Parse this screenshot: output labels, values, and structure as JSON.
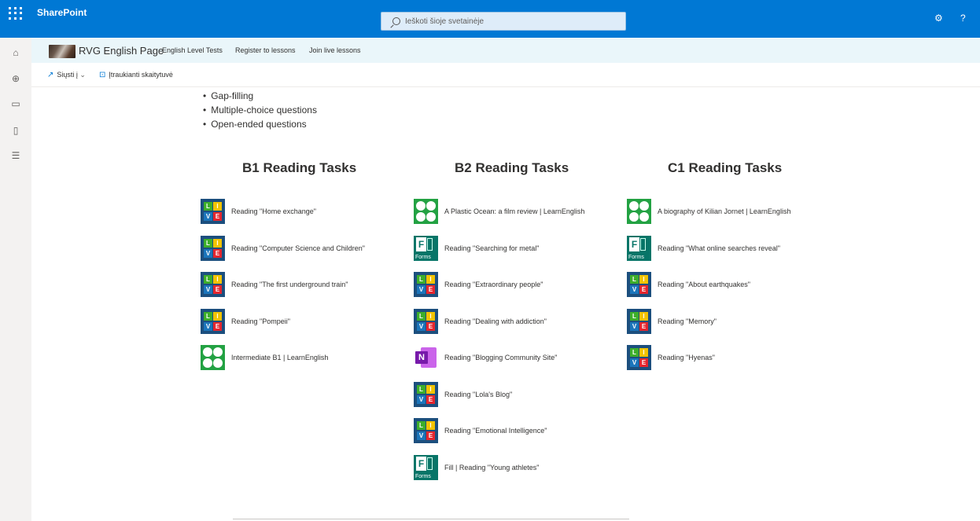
{
  "topbar": {
    "brand": "SharePoint",
    "search_placeholder": "Ieškoti šioje svetainėje",
    "settings_icon": "gear-icon",
    "help_label": "?"
  },
  "site": {
    "title": "RVG English Page",
    "nav": [
      "English Level Tests",
      "Register to lessons",
      "Join live lessons"
    ]
  },
  "commands": {
    "send_label": "Siųsti į",
    "reader_label": "Įtraukianti skaitytuvė"
  },
  "bullets": [
    "Gap-filling",
    "Multiple-choice questions",
    "Open-ended questions"
  ],
  "columns": [
    {
      "title": "B1 Reading Tasks",
      "items": [
        {
          "icon": "live",
          "label": "Reading \"Home exchange\""
        },
        {
          "icon": "live",
          "label": "Reading \"Computer Science and Children\""
        },
        {
          "icon": "live",
          "label": "Reading \"The first underground train\""
        },
        {
          "icon": "live",
          "label": "Reading \"Pompeii\""
        },
        {
          "icon": "learnenglish",
          "label": "Intermediate B1 | LearnEnglish"
        }
      ]
    },
    {
      "title": "B2 Reading Tasks",
      "items": [
        {
          "icon": "learnenglish",
          "label": "A Plastic Ocean: a film review | LearnEnglish"
        },
        {
          "icon": "forms",
          "label": "Reading \"Searching for metal\""
        },
        {
          "icon": "live",
          "label": "Reading \"Extraordinary people\""
        },
        {
          "icon": "live",
          "label": "Reading \"Dealing with addiction\""
        },
        {
          "icon": "onenote",
          "label": "Reading \"Blogging Community Site\""
        },
        {
          "icon": "live",
          "label": "Reading \"Lola's Blog\""
        },
        {
          "icon": "live",
          "label": "Reading \"Emotional Intelligence\""
        },
        {
          "icon": "forms",
          "label": "Fill | Reading \"Young athletes\""
        }
      ]
    },
    {
      "title": "C1 Reading Tasks",
      "items": [
        {
          "icon": "learnenglish",
          "label": "A biography of Kilian Jornet | LearnEnglish"
        },
        {
          "icon": "forms",
          "label": "Reading \"What online searches reveal\""
        },
        {
          "icon": "live",
          "label": "Reading \"About earthquakes\""
        },
        {
          "icon": "live",
          "label": "Reading \"Memory\""
        },
        {
          "icon": "live",
          "label": "Reading \"Hyenas\""
        }
      ]
    }
  ],
  "icon_text": {
    "live": [
      "L",
      "I",
      "V",
      "E"
    ],
    "onenote": "N",
    "forms": "F",
    "forms_caption": "Forms"
  },
  "colors": {
    "accent": "#0078d4",
    "sitebar": "#eaf6fa",
    "live_bg": "#1c4f7e",
    "learnenglish": "#23a243",
    "forms": "#077568",
    "onenote": "#7719aa"
  }
}
